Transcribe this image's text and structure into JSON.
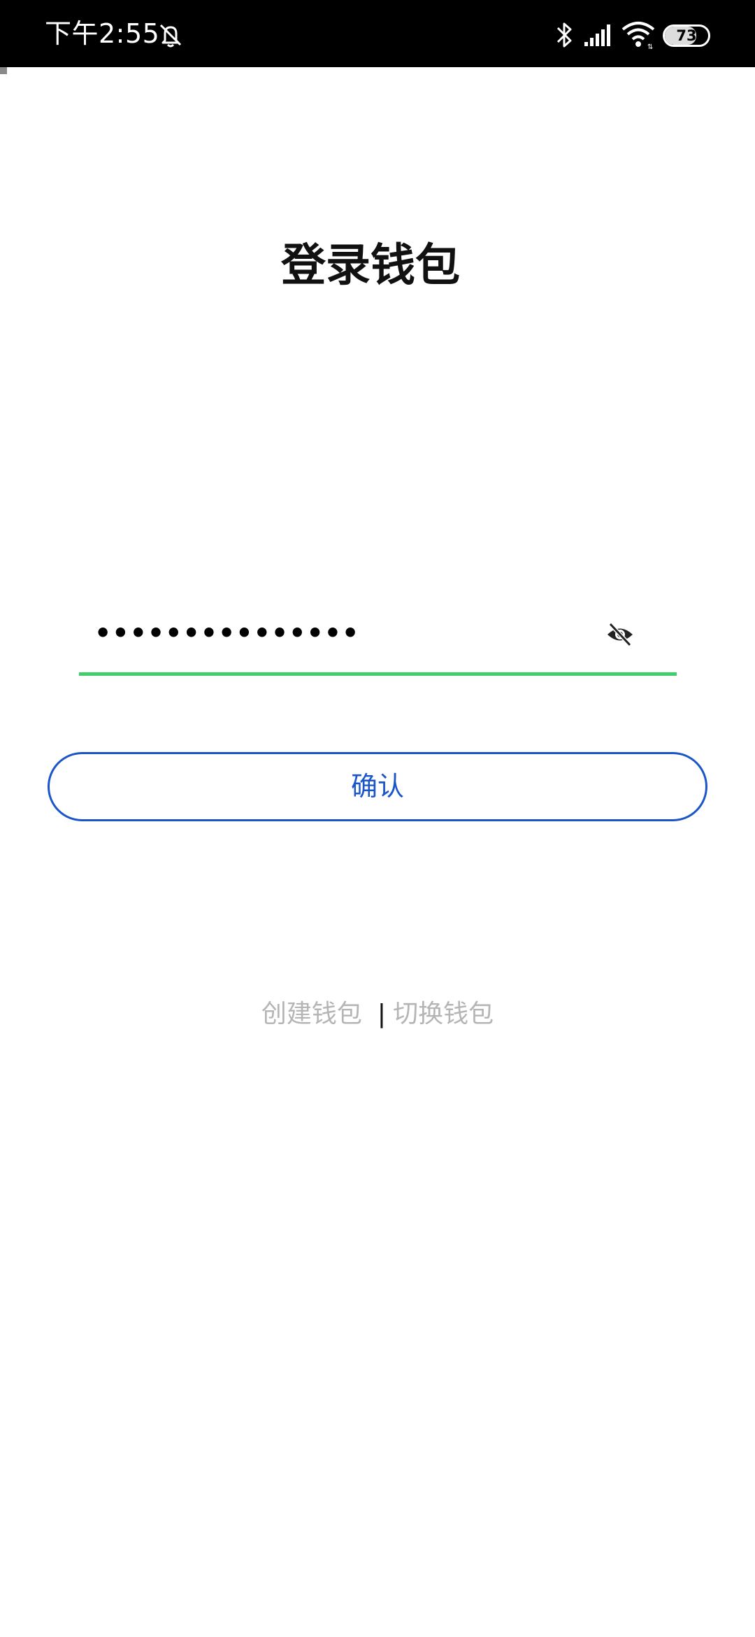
{
  "status_bar": {
    "time": "下午2:55",
    "battery_level": "73",
    "icons": [
      "bell-off-icon",
      "bluetooth-icon",
      "cellular-signal-icon",
      "wifi-icon",
      "battery-icon"
    ]
  },
  "page": {
    "title": "登录钱包"
  },
  "password_field": {
    "value": "•••••••••••••••",
    "visibility_toggle_icon": "eye-off-icon",
    "underline_color": "#3fcf6b"
  },
  "confirm_button": {
    "label": "确认",
    "color": "#1a55c9"
  },
  "links": {
    "create_wallet": "创建钱包",
    "separator": "|",
    "switch_wallet": "切换钱包"
  }
}
